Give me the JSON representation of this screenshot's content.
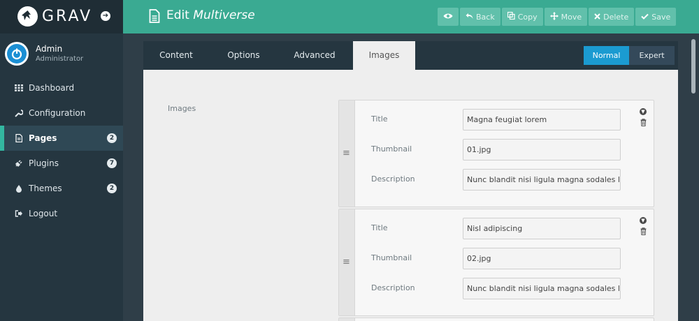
{
  "app": {
    "logo_text": "GRAV",
    "collapse_glyph": "«",
    "logo_arrow_glyph": "➔"
  },
  "user": {
    "name": "Admin",
    "role": "Administrator"
  },
  "nav": [
    {
      "label": "Dashboard",
      "icon": "grid-icon",
      "badge": ""
    },
    {
      "label": "Configuration",
      "icon": "wrench-icon",
      "badge": ""
    },
    {
      "label": "Pages",
      "icon": "file-icon",
      "badge": "2",
      "active": true
    },
    {
      "label": "Plugins",
      "icon": "plug-icon",
      "badge": "7"
    },
    {
      "label": "Themes",
      "icon": "drop-icon",
      "badge": "2"
    },
    {
      "label": "Logout",
      "icon": "logout-icon",
      "badge": ""
    }
  ],
  "header": {
    "title_prefix": "Edit",
    "title_page": "Multiverse",
    "actions": {
      "back": "Back",
      "copy": "Copy",
      "move": "Move",
      "delete": "Delete",
      "save": "Save"
    }
  },
  "tabs": [
    "Content",
    "Options",
    "Advanced",
    "Images"
  ],
  "mode": {
    "normal": "Normal",
    "expert": "Expert",
    "selected": "Normal"
  },
  "images_field": {
    "label": "Images",
    "row_labels": {
      "title": "Title",
      "thumbnail": "Thumbnail",
      "description": "Description"
    },
    "items": [
      {
        "title": "Magna feugiat lorem",
        "thumbnail": "01.jpg",
        "description": "Nunc blandit nisi ligula magna sodales lectu"
      },
      {
        "title": "Nisl adipiscing",
        "thumbnail": "02.jpg",
        "description": "Nunc blandit nisi ligula magna sodales lectu"
      }
    ]
  },
  "colors": {
    "header": "#3aaa92",
    "sidebar": "#253640",
    "accent": "#33b7a1",
    "mode_active": "#1b9bd1"
  }
}
